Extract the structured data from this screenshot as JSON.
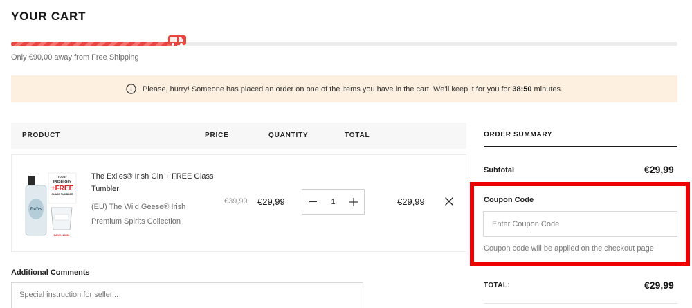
{
  "page": {
    "title": "YOUR CART"
  },
  "shipping": {
    "progress_fraction": 0.25,
    "message": "Only €90,00 away from Free Shipping",
    "icon": "truck-icon",
    "accent_color": "#e8473f"
  },
  "urgency": {
    "icon": "info-icon",
    "text_before": "Please, hurry! Someone has placed an order on one of the items you have in the cart. We'll keep it for you for",
    "timer": "38:50",
    "text_after": "minutes."
  },
  "table": {
    "headers": {
      "product": "PRODUCT",
      "price": "PRICE",
      "quantity": "QUANTITY",
      "total": "TOTAL"
    }
  },
  "cart_item": {
    "name": "The Exiles® Irish Gin + FREE Glass Tumbler",
    "vendor": "(EU) The Wild Geese® Irish Premium Spirits Collection",
    "compare_price": "€39,99",
    "price": "€29,99",
    "quantity": "1",
    "line_total": "€29,99",
    "image_badge": {
      "line1": "TODAY",
      "line2": "IRISH GIN",
      "line3": "+FREE",
      "line4": "GLASS TUMBLER",
      "save": "SAVE: 20.00"
    }
  },
  "comments": {
    "label": "Additional Comments",
    "placeholder": "Special instruction for seller..."
  },
  "summary": {
    "title": "ORDER SUMMARY",
    "subtotal_label": "Subtotal",
    "subtotal_value": "€29,99",
    "coupon_label": "Coupon Code",
    "coupon_placeholder": "Enter Coupon Code",
    "coupon_note": "Coupon code will be applied on the checkout page",
    "total_label": "TOTAL:",
    "total_value": "€29,99",
    "highlight_color": "#ee0000"
  }
}
